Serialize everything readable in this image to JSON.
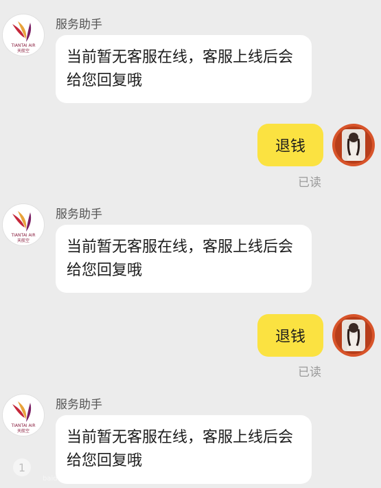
{
  "messages": [
    {
      "sender": "服务助手",
      "text": "当前暂无客服在线，客服上线后会给您回复哦"
    },
    {
      "user_text": "退钱",
      "status": "已读"
    },
    {
      "sender": "服务助手",
      "text": "当前暂无客服在线，客服上线后会给您回复哦"
    },
    {
      "user_text": "退钱",
      "status": "已读"
    },
    {
      "sender": "服务助手",
      "text": "当前暂无客服在线，客服上线后会给您回复哦"
    }
  ],
  "logo": {
    "line1": "TIANTAI AIR",
    "line2": "天航空"
  },
  "watermark": "baidu",
  "colors": {
    "background": "#ececec",
    "user_bubble": "#fbe241",
    "assistant_bubble": "#ffffff"
  }
}
